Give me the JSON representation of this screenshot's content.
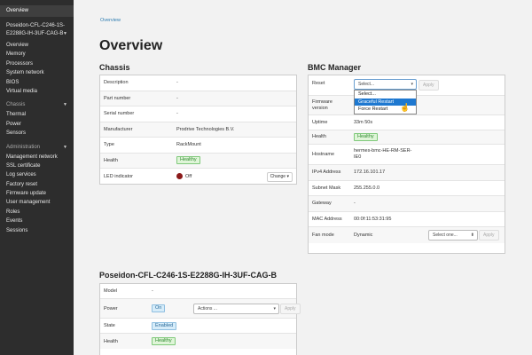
{
  "sidebar": {
    "overview": "Overview",
    "system_name": "Poseidon-CFL-C246-1S-E2288G-IH-3UF-CAG-B",
    "system_name_line1": "Poseidon-CFL-C246-1S-",
    "system_name_line2": "E2288G-IH-3UF-CAG-B",
    "system_items": [
      "Overview",
      "Memory",
      "Processors",
      "System network",
      "BIOS",
      "Virtual media"
    ],
    "chassis_label": "Chassis",
    "chassis_items": [
      "Thermal",
      "Power",
      "Sensors"
    ],
    "admin_label": "Administration",
    "admin_items": [
      "Management network",
      "SSL certificate",
      "Log services",
      "Factory reset",
      "Firmware update",
      "User management",
      "Roles",
      "Events",
      "Sessions"
    ]
  },
  "breadcrumb": "Overview",
  "page_title": "Overview",
  "chassis": {
    "title": "Chassis",
    "rows": [
      {
        "label": "Description",
        "value": "-"
      },
      {
        "label": "Part number",
        "value": "-"
      },
      {
        "label": "Serial number",
        "value": "-"
      },
      {
        "label": "Manufacturer",
        "value": "Prodrive Technologies B.V."
      },
      {
        "label": "Type",
        "value": "RackMount"
      },
      {
        "label": "Health",
        "value": "Healthy"
      },
      {
        "label": "LED indicator",
        "value": "Off"
      }
    ],
    "change_label": "Change"
  },
  "bmc": {
    "title": "BMC Manager",
    "reset_label": "Reset",
    "reset_select_value": "Select...",
    "apply_label": "Apply",
    "dropdown_options": [
      "Select...",
      "Graceful Restart",
      "Force Restart"
    ],
    "dropdown_selected_index": 1,
    "rows": [
      {
        "label": "Firmware version",
        "value": ""
      },
      {
        "label": "Uptime",
        "value": "33m 50s"
      },
      {
        "label": "Health",
        "value": "Healthy"
      },
      {
        "label": "Hostname",
        "value": "hermes-bmc-HE-RM-SER-IE0"
      },
      {
        "label": "IPv4 Address",
        "value": "172.16.101.17"
      },
      {
        "label": "Subnet Mask",
        "value": "255.255.0.0"
      },
      {
        "label": "Gateway",
        "value": "-"
      },
      {
        "label": "MAC Address",
        "value": "00:0f:11:53:31:95"
      },
      {
        "label": "Fan mode",
        "value": "Dynamic"
      }
    ],
    "firmware_label_line1": "Firmware",
    "firmware_label_line2": "version",
    "hostname_line1": "hermes-bmc-HE-RM-SER-",
    "hostname_line2": "IE0",
    "fan_select_value": "Select one...",
    "fan_apply_label": "Apply"
  },
  "system": {
    "title": "Poseidon-CFL-C246-1S-E2288G-IH-3UF-CAG-B",
    "rows": [
      {
        "label": "Model",
        "value": "-"
      },
      {
        "label": "Power",
        "value": "On"
      },
      {
        "label": "State",
        "value": "Enabled"
      },
      {
        "label": "Health",
        "value": "Healthy"
      }
    ],
    "actions_select_value": "Actions ...",
    "apply_label": "Apply"
  },
  "colors": {
    "sidebar_bg": "#2d2d2d",
    "link": "#2a7ab0",
    "healthy_green": "#2f8a2f",
    "dropdown_highlight": "#1e78d0",
    "led_off": "#8b1a1a"
  }
}
